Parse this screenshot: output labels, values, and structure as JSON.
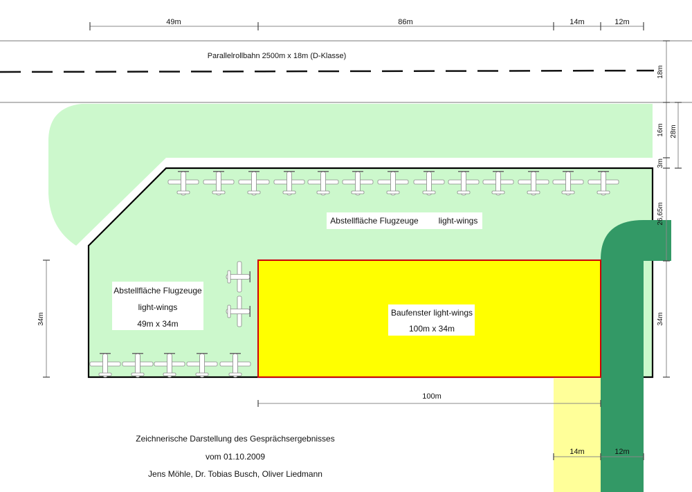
{
  "colors": {
    "green_area": "#ccf8cc",
    "dark_green": "#339966",
    "yellow": "#ffff00",
    "light_yellow": "#ffff99",
    "outline_black": "#000000",
    "outline_red": "#cc0000"
  },
  "top_dims": {
    "d1": "49m",
    "d2": "86m",
    "d3": "14m",
    "d4": "12m"
  },
  "taxiway": {
    "label": "Parallelrollbahn 2500m x 18m (D-Klasse)"
  },
  "right_dims": {
    "d18": "18m",
    "d28": "28m",
    "d16": "16m",
    "d3": "3m",
    "d2665": "26,65m",
    "d34": "34m"
  },
  "left_dims": {
    "d34": "34m"
  },
  "bottom_dims": {
    "d100": "100m",
    "d14": "14m",
    "d12": "12m"
  },
  "areas": {
    "main_label_left": "Abstellfläche Flugzeuge",
    "main_label_right": "light-wings",
    "left_box": {
      "line1": "Abstellfläche Flugzeuge",
      "line2": "light-wings",
      "line3": "49m x 34m"
    },
    "building": {
      "line1": "Baufenster light-wings",
      "line2": "100m x 34m"
    }
  },
  "caption": {
    "line1": "Zeichnerische Darstellung des Gesprächsergebnisses",
    "line2": "vom 01.10.2009",
    "line3": "Jens Möhle, Dr. Tobias Busch, Oliver Liedmann"
  },
  "icons": {
    "aircraft": "light-aircraft-icon"
  }
}
